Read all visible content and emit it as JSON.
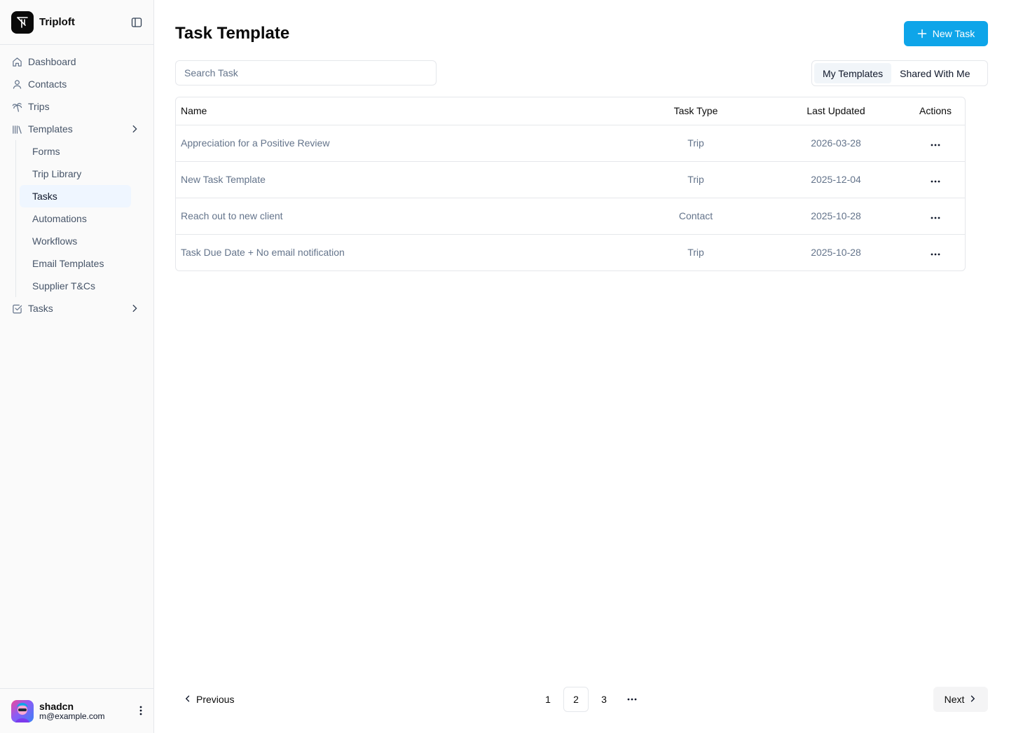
{
  "app": {
    "name": "Triploft"
  },
  "sidebar": {
    "items": [
      {
        "label": "Dashboard",
        "icon": "home-icon"
      },
      {
        "label": "Contacts",
        "icon": "user-icon"
      },
      {
        "label": "Trips",
        "icon": "palm-tree-icon"
      },
      {
        "label": "Templates",
        "icon": "library-icon",
        "expandable": true
      }
    ],
    "template_children": [
      "Forms",
      "Trip Library",
      "Tasks",
      "Automations",
      "Workflows",
      "Email Templates",
      "Supplier T&Cs"
    ],
    "active_child": "Tasks",
    "tasks_item": {
      "label": "Tasks",
      "icon": "checkbox-icon",
      "expandable": true
    }
  },
  "user": {
    "name": "shadcn",
    "email": "m@example.com"
  },
  "page": {
    "title": "Task Template",
    "new_button": "New Task",
    "search_placeholder": "Search Task",
    "segments": [
      "My Templates",
      "Shared With Me"
    ],
    "active_segment": "My Templates"
  },
  "table": {
    "headers": [
      "Name",
      "Task Type",
      "Last Updated",
      "Actions"
    ],
    "rows": [
      {
        "name": "Appreciation for a Positive Review",
        "type": "Trip",
        "updated": "2026-03-28"
      },
      {
        "name": "New Task Template",
        "type": "Trip",
        "updated": "2025-12-04"
      },
      {
        "name": "Reach out to new client",
        "type": "Contact",
        "updated": "2025-10-28"
      },
      {
        "name": "Task Due Date + No email notification",
        "type": "Trip",
        "updated": "2025-10-28"
      }
    ]
  },
  "pagination": {
    "previous": "Previous",
    "next": "Next",
    "pages": [
      "1",
      "2",
      "3"
    ],
    "current": "2"
  },
  "colors": {
    "accent": "#0ea5e9",
    "active_bg": "#eff6ff"
  }
}
